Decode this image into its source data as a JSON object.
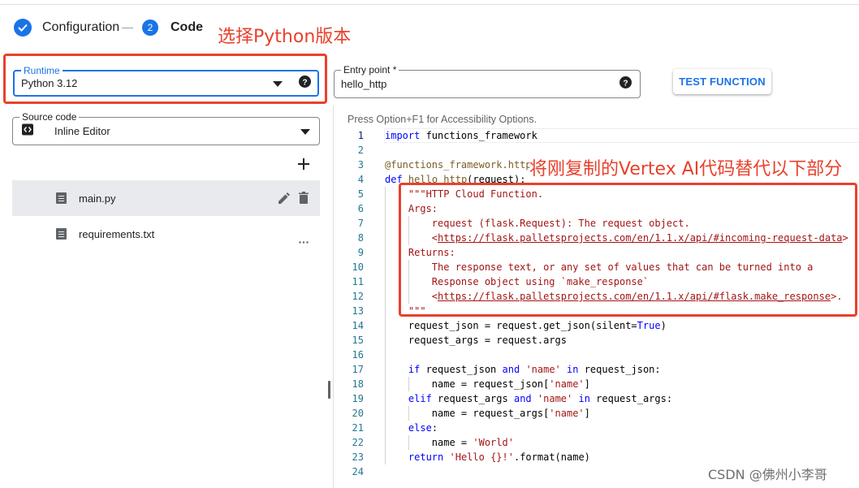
{
  "stepper": {
    "step1_label": "Configuration",
    "step2_number": "2",
    "step2_label": "Code"
  },
  "annotations": {
    "runtime_note": "选择Python版本",
    "code_note": "将刚复制的Vertex AI代码替代以下部分"
  },
  "runtime": {
    "label": "Runtime",
    "value": "Python 3.12"
  },
  "entry_point": {
    "label": "Entry point *",
    "value": "hello_http"
  },
  "test_button_label": "TEST FUNCTION",
  "source_code": {
    "label": "Source code",
    "value": "Inline Editor"
  },
  "files": [
    {
      "name": "main.py"
    },
    {
      "name": "requirements.txt"
    }
  ],
  "editor": {
    "accessibility_hint": "Press Option+F1 for Accessibility Options.",
    "line_numbers": [
      "1",
      "2",
      "3",
      "4",
      "5",
      "6",
      "7",
      "8",
      "9",
      "10",
      "11",
      "12",
      "13",
      "14",
      "15",
      "16",
      "17",
      "18",
      "19",
      "20",
      "21",
      "22",
      "23",
      "24"
    ]
  },
  "colors": {
    "accent": "#1a73e8",
    "annotation_red": "#e8412c",
    "keyword": "#0000ff",
    "string": "#a31515",
    "decorator": "#795e26"
  },
  "icons": {
    "step1": "check-circle-icon",
    "dropdown": "arrow-drop-down-icon",
    "help": "help-icon",
    "source": "code-icon",
    "add": "add-icon",
    "edit": "edit-icon",
    "delete": "delete-icon",
    "more": "more-horiz-icon",
    "file": "file-icon"
  },
  "watermark": "CSDN @佛州小李哥"
}
